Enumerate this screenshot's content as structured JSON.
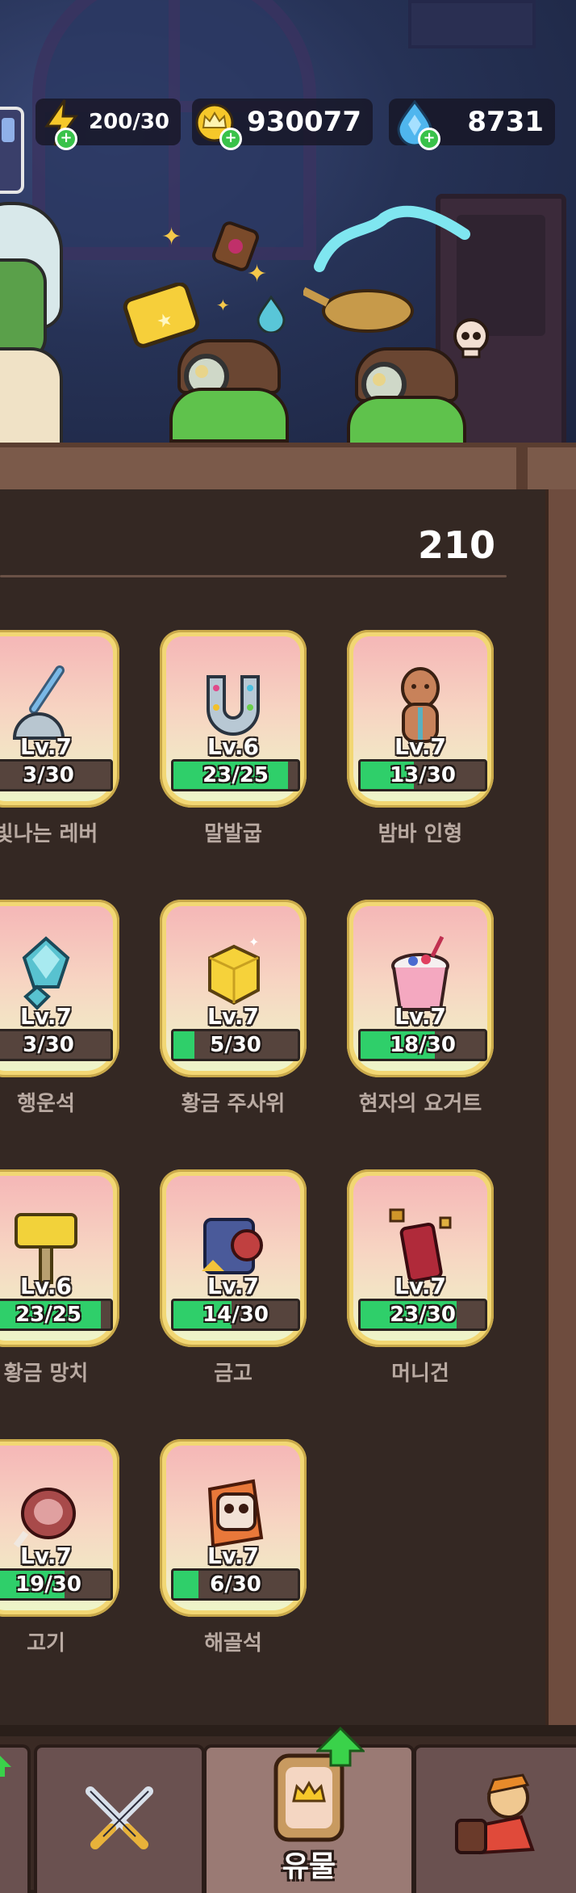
{
  "resources": {
    "energy": {
      "value": "200/30",
      "icon": "lightning-icon"
    },
    "gold": {
      "value": "930077",
      "icon": "crown-coin-icon"
    },
    "gems": {
      "value": "8731",
      "icon": "gem-icon"
    }
  },
  "collection": {
    "count": "210"
  },
  "items": [
    {
      "name": "빛나는 레버",
      "name_visible": "빛나는 레버",
      "level": "Lv.7",
      "progress": "3/30",
      "fill": 0.1,
      "icon": "lever-icon"
    },
    {
      "name": "말발굽",
      "level": "Lv.6",
      "progress": "23/25",
      "fill": 0.92,
      "icon": "horseshoe-icon"
    },
    {
      "name": "밤바 인형",
      "level": "Lv.7",
      "progress": "13/30",
      "fill": 0.43,
      "icon": "doll-icon"
    },
    {
      "name": "행운석",
      "level": "Lv.7",
      "progress": "3/30",
      "fill": 0.1,
      "icon": "luck-stone-icon"
    },
    {
      "name": "황금 주사위",
      "level": "Lv.7",
      "progress": "5/30",
      "fill": 0.17,
      "icon": "golden-dice-icon"
    },
    {
      "name": "현자의 요거트",
      "level": "Lv.7",
      "progress": "18/30",
      "fill": 0.6,
      "icon": "yogurt-icon"
    },
    {
      "name": "황금 망치",
      "level": "Lv.6",
      "progress": "23/25",
      "fill": 0.92,
      "icon": "golden-hammer-icon"
    },
    {
      "name": "금고",
      "level": "Lv.7",
      "progress": "14/30",
      "fill": 0.47,
      "icon": "safe-icon"
    },
    {
      "name": "머니건",
      "level": "Lv.7",
      "progress": "23/30",
      "fill": 0.77,
      "icon": "money-gun-icon"
    },
    {
      "name": "고기",
      "level": "Lv.7",
      "progress": "19/30",
      "fill": 0.63,
      "icon": "meat-icon"
    },
    {
      "name": "해골석",
      "level": "Lv.7",
      "progress": "6/30",
      "fill": 0.2,
      "icon": "skull-stone-icon"
    }
  ],
  "nav": {
    "battle_icon": "crossed-swords-icon",
    "relic_label": "유물",
    "relic_icon": "relic-card-icon",
    "hero_icon": "hero-icon"
  },
  "colors": {
    "progress_fill": "#2fcf6a",
    "card_frame": "#f2d774",
    "panel_bg": "#342823"
  }
}
